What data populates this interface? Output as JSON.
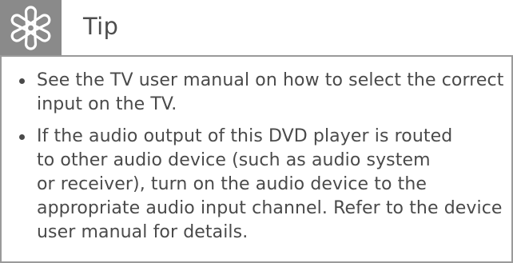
{
  "tip": {
    "icon": "asterisk-icon",
    "title": "Tip",
    "items": [
      {
        "text": "See the TV user manual on how to select the correct\ninput on the TV."
      },
      {
        "text": "If the audio output of this DVD player is routed\nto other audio device (such as audio system\nor receiver), turn on the audio device to the\nappropriate audio input channel. Refer to the device\nuser manual for details."
      }
    ]
  },
  "colors": {
    "icon_background": "#8a8a8a",
    "border": "#9a9a9a",
    "text": "#4a4a4a"
  }
}
